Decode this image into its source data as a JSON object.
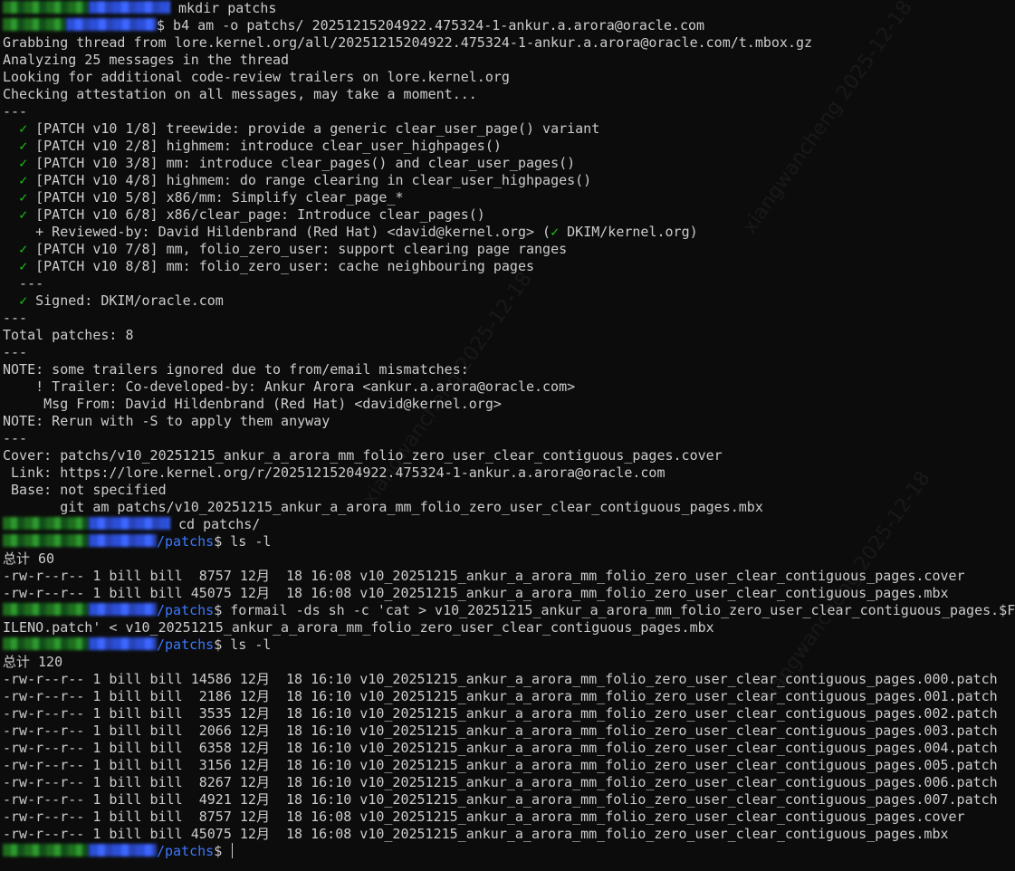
{
  "colors": {
    "background": "#0c0c0c",
    "text": "#cccccc",
    "path": "#3b78ff",
    "check": "#16c60c"
  },
  "prompt_dollar": "$",
  "line_mkdir": " mkdir patchs",
  "line_b4_cmd": " b4 am -o patchs/ 20251215204922.475324-1-ankur.a.arora@oracle.com",
  "output_b4": [
    "Grabbing thread from lore.kernel.org/all/20251215204922.475324-1-ankur.a.arora@oracle.com/t.mbox.gz",
    "Analyzing 25 messages in the thread",
    "Looking for additional code-review trailers on lore.kernel.org",
    "Checking attestation on all messages, may take a moment...",
    "---"
  ],
  "check_glyph": "✓",
  "patches": [
    "[PATCH v10 1/8] treewide: provide a generic clear_user_page() variant",
    "[PATCH v10 2/8] highmem: introduce clear_user_highpages()",
    "[PATCH v10 3/8] mm: introduce clear_pages() and clear_user_pages()",
    "[PATCH v10 4/8] highmem: do range clearing in clear_user_highpages()",
    "[PATCH v10 5/8] x86/mm: Simplify clear_page_*",
    "[PATCH v10 6/8] x86/clear_page: Introduce clear_pages()"
  ],
  "reviewed_by_text": "+ Reviewed-by: David Hildenbrand (Red Hat) <david@kernel.org> (",
  "reviewed_by_dkim": " DKIM/kernel.org)",
  "patches_after": [
    "[PATCH v10 7/8] mm, folio_zero_user: support clearing page ranges",
    "[PATCH v10 8/8] mm: folio_zero_user: cache neighbouring pages"
  ],
  "sep_indented": "  ---",
  "signed": "Signed: DKIM/oracle.com",
  "summary_lines": [
    "---",
    "Total patches: 8",
    "---",
    "NOTE: some trailers ignored due to from/email mismatches:",
    "    ! Trailer: Co-developed-by: Ankur Arora <ankur.a.arora@oracle.com>",
    "     Msg From: David Hildenbrand (Red Hat) <david@kernel.org>",
    "NOTE: Rerun with -S to apply them anyway",
    "---",
    "Cover: patchs/v10_20251215_ankur_a_arora_mm_folio_zero_user_clear_contiguous_pages.cover",
    " Link: https://lore.kernel.org/r/20251215204922.475324-1-ankur.a.arora@oracle.com",
    " Base: not specified",
    "       git am patchs/v10_20251215_ankur_a_arora_mm_folio_zero_user_clear_contiguous_pages.mbx"
  ],
  "line_cd": " cd patchs/",
  "prompt_path": "/patchs",
  "cmd_ls": " ls -l",
  "total_1": "总计 60",
  "listing_1": [
    "-rw-r--r-- 1 bill bill  8757 12月  18 16:08 v10_20251215_ankur_a_arora_mm_folio_zero_user_clear_contiguous_pages.cover",
    "-rw-r--r-- 1 bill bill 45075 12月  18 16:08 v10_20251215_ankur_a_arora_mm_folio_zero_user_clear_contiguous_pages.mbx"
  ],
  "cmd_formail": " formail -ds sh -c 'cat > v10_20251215_ankur_a_arora_mm_folio_zero_user_clear_contiguous_pages.$F",
  "cmd_formail_wrap": "ILENO.patch' < v10_20251215_ankur_a_arora_mm_folio_zero_user_clear_contiguous_pages.mbx",
  "total_2": "总计 120",
  "listing_2": [
    "-rw-r--r-- 1 bill bill 14586 12月  18 16:10 v10_20251215_ankur_a_arora_mm_folio_zero_user_clear_contiguous_pages.000.patch",
    "-rw-r--r-- 1 bill bill  2186 12月  18 16:10 v10_20251215_ankur_a_arora_mm_folio_zero_user_clear_contiguous_pages.001.patch",
    "-rw-r--r-- 1 bill bill  3535 12月  18 16:10 v10_20251215_ankur_a_arora_mm_folio_zero_user_clear_contiguous_pages.002.patch",
    "-rw-r--r-- 1 bill bill  2066 12月  18 16:10 v10_20251215_ankur_a_arora_mm_folio_zero_user_clear_contiguous_pages.003.patch",
    "-rw-r--r-- 1 bill bill  6358 12月  18 16:10 v10_20251215_ankur_a_arora_mm_folio_zero_user_clear_contiguous_pages.004.patch",
    "-rw-r--r-- 1 bill bill  3156 12月  18 16:10 v10_20251215_ankur_a_arora_mm_folio_zero_user_clear_contiguous_pages.005.patch",
    "-rw-r--r-- 1 bill bill  8267 12月  18 16:10 v10_20251215_ankur_a_arora_mm_folio_zero_user_clear_contiguous_pages.006.patch",
    "-rw-r--r-- 1 bill bill  4921 12月  18 16:10 v10_20251215_ankur_a_arora_mm_folio_zero_user_clear_contiguous_pages.007.patch",
    "-rw-r--r-- 1 bill bill  8757 12月  18 16:08 v10_20251215_ankur_a_arora_mm_folio_zero_user_clear_contiguous_pages.cover",
    "-rw-r--r-- 1 bill bill 45075 12月  18 16:08 v10_20251215_ankur_a_arora_mm_folio_zero_user_clear_contiguous_pages.mbx"
  ],
  "watermark": "xiangwancheng 2025-12-18"
}
